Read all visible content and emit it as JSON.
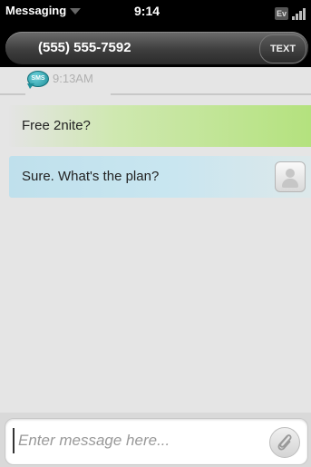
{
  "status_bar": {
    "app_name": "Messaging",
    "time": "9:14",
    "network": "Ev"
  },
  "header": {
    "contact": "(555) 555-7592",
    "mode_button": "TEXT"
  },
  "conversation": {
    "service_badge": "SMS",
    "timestamp": "9:13AM",
    "messages": [
      {
        "direction": "incoming",
        "text": "Free 2nite?"
      },
      {
        "direction": "outgoing",
        "text": "Sure. What's the plan?"
      }
    ]
  },
  "compose": {
    "placeholder": "Enter message here...",
    "value": ""
  },
  "icons": {
    "app_menu": "chevron-down-icon",
    "signal": "signal-bars-icon",
    "sms": "sms-bubble-icon",
    "avatar": "contact-avatar-icon",
    "attach": "paperclip-icon"
  },
  "colors": {
    "incoming_bubble": "#b4e27e",
    "outgoing_bubble": "#bfe0ec",
    "header_bg": "#000000",
    "sms_badge": "#1f8f99"
  }
}
